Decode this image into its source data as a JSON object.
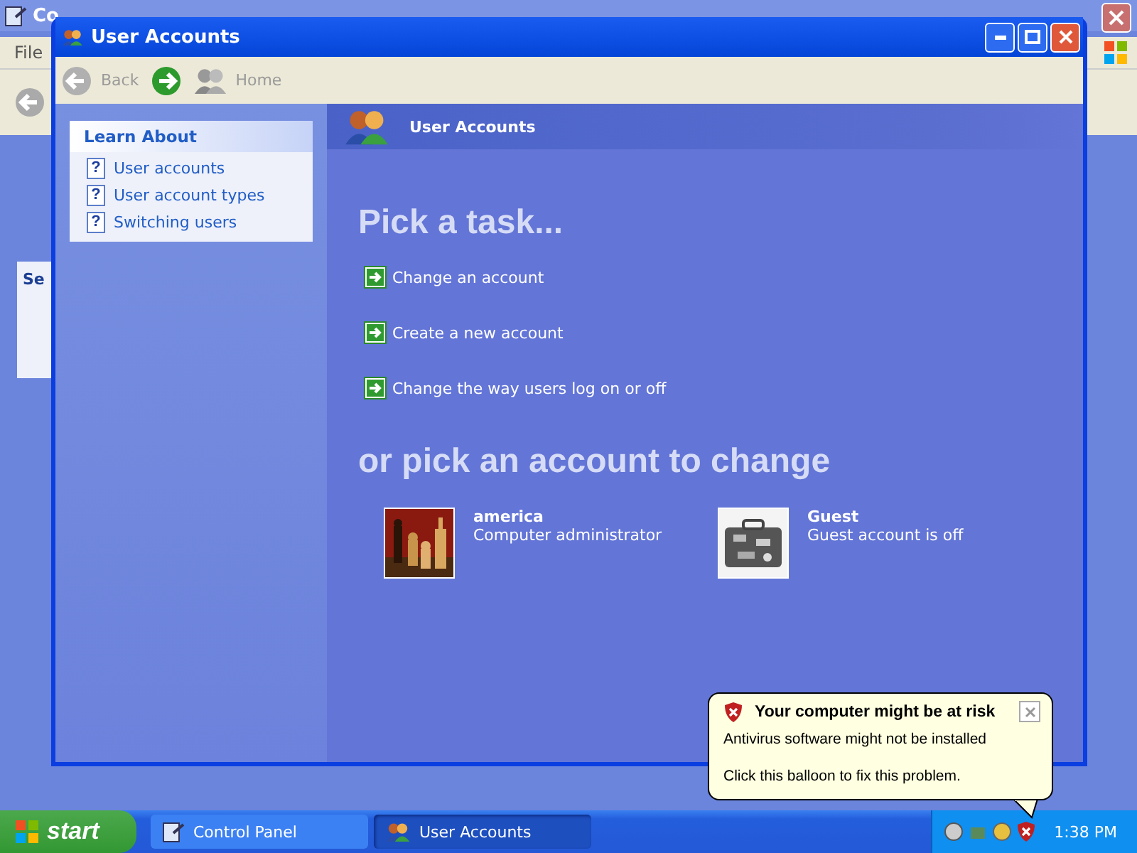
{
  "background_window": {
    "title": "Co",
    "menu": [
      "File"
    ],
    "sidebar_heading": "Se"
  },
  "window": {
    "title": "User Accounts"
  },
  "toolbar": {
    "back": "Back",
    "home": "Home"
  },
  "learn_about": {
    "title": "Learn About",
    "items": [
      {
        "icon": "?",
        "label": "User accounts"
      },
      {
        "icon": "?",
        "label": "User account types"
      },
      {
        "icon": "?",
        "label": "Switching users"
      }
    ]
  },
  "header": {
    "title": "User Accounts"
  },
  "pick_task": {
    "heading": "Pick a task...",
    "tasks": [
      "Change an account",
      "Create a new account",
      "Change the way users log on or off"
    ]
  },
  "accounts": {
    "heading": "or pick an account to change",
    "items": [
      {
        "name": "america",
        "type": "Computer administrator"
      },
      {
        "name": "Guest",
        "type": "Guest account is off"
      }
    ]
  },
  "balloon": {
    "title": "Your computer might be at risk",
    "lines": [
      "Antivirus software might not be installed",
      "Click this balloon to fix this problem."
    ]
  },
  "taskbar": {
    "start": "start",
    "tasks": [
      {
        "label": "Control Panel",
        "selected": false
      },
      {
        "label": "User Accounts",
        "selected": true
      }
    ],
    "clock": "1:38 PM"
  }
}
